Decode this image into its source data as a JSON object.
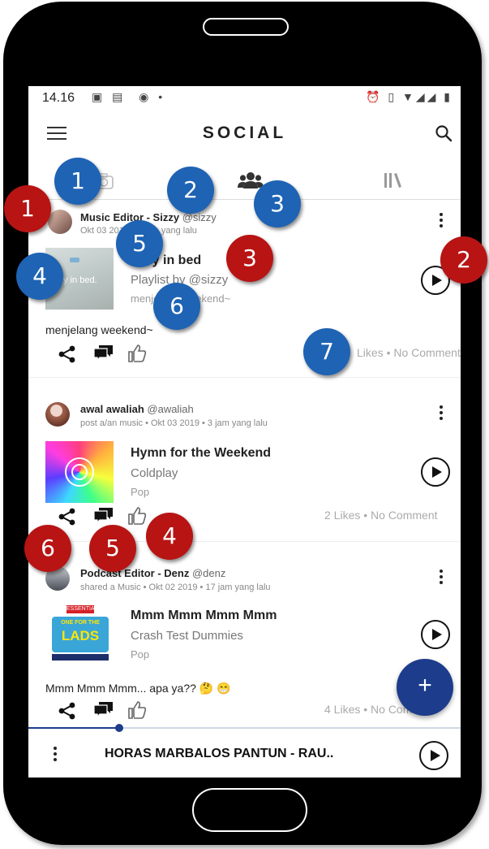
{
  "status_bar": {
    "time": "14.16"
  },
  "app": {
    "title": "SOCIAL"
  },
  "tabs": [
    {
      "name": "camera-tab"
    },
    {
      "name": "social-tab",
      "active": true
    },
    {
      "name": "library-tab"
    }
  ],
  "posts": [
    {
      "author": "Music Editor - Sizzy",
      "handle": "@sizzy",
      "meta": "Okt 03 2019 • 3 jam yang lalu",
      "track_title": "Lazy in bed",
      "track_sub": "Playlist by @sizzy",
      "track_genre": "menjelang weekend~",
      "cover_text": "lazy in bed.",
      "caption": "menjelang weekend~",
      "stats": "Likes • No Comment"
    },
    {
      "author": "awal awaliah",
      "handle": "@awaliah",
      "meta": "post a/an music • Okt 03 2019 • 3 jam yang lalu",
      "track_title": "Hymn for the Weekend",
      "track_sub": "Coldplay",
      "track_genre": "Pop",
      "stats": "2 Likes • No Comment"
    },
    {
      "author": "Podcast Editor - Denz",
      "handle": "@denz",
      "meta": "shared a Music • Okt 02 2019 • 17 jam yang lalu",
      "track_title": "Mmm Mmm Mmm Mmm",
      "track_sub": "Crash Test Dummies",
      "track_genre": "Pop",
      "cover_line1": "ESSENTIAL",
      "cover_line2": "ONE FOR THE",
      "cover_line3": "LADS",
      "caption": "Mmm Mmm Mmm... apa ya?? 🤔 😁",
      "stats": "4 Likes • No Comment"
    }
  ],
  "fab": {
    "label": "+"
  },
  "player": {
    "title": "HORAS MARBALOS PANTUN - RAU..",
    "progress": 0.21
  },
  "colors": {
    "accent": "#1d3c8c",
    "badge_blue": "#1e63b4",
    "badge_red": "#b81414"
  },
  "badges": {
    "blue": [
      "1",
      "2",
      "3",
      "4",
      "5",
      "6",
      "7"
    ],
    "red": [
      "1",
      "2",
      "3",
      "4",
      "5",
      "6"
    ]
  }
}
